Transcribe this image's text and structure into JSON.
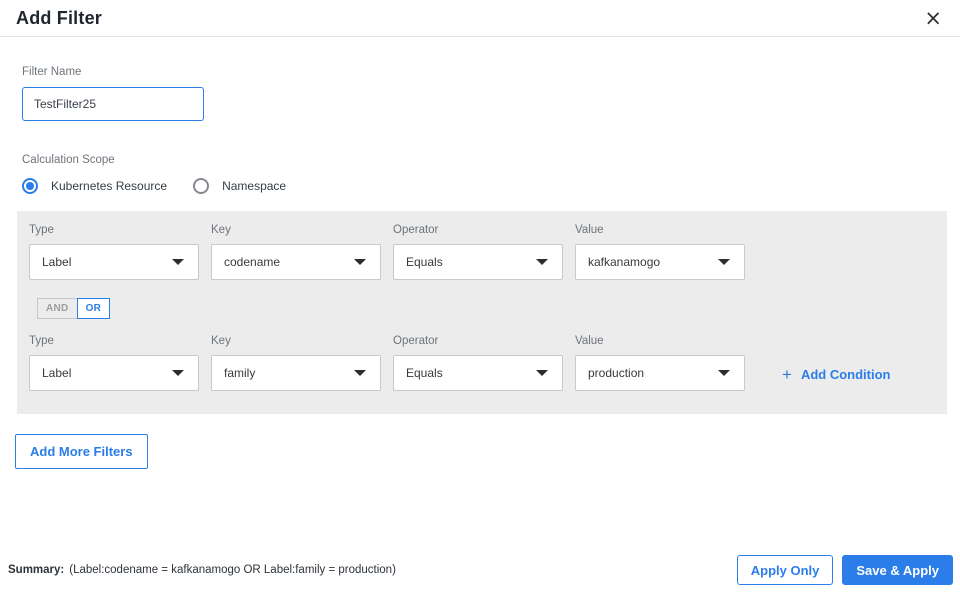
{
  "dialog": {
    "title": "Add Filter",
    "close_icon": "×"
  },
  "filter_name": {
    "label": "Filter Name",
    "value": "TestFilter25"
  },
  "calculation_scope": {
    "label": "Calculation Scope",
    "options": [
      {
        "label": "Kubernetes Resource",
        "selected": true
      },
      {
        "label": "Namespace",
        "selected": false
      }
    ]
  },
  "conditions": {
    "column_labels": {
      "type": "Type",
      "key": "Key",
      "operator": "Operator",
      "value": "Value"
    },
    "rows": [
      {
        "type": "Label",
        "key": "codename",
        "operator": "Equals",
        "value": "kafkanamogo"
      },
      {
        "type": "Label",
        "key": "family",
        "operator": "Equals",
        "value": "production"
      }
    ],
    "logic_toggle": {
      "and_label": "AND",
      "or_label": "OR",
      "selected": "OR"
    },
    "add_condition": {
      "plus_icon": "+",
      "label": "Add Condition"
    }
  },
  "buttons": {
    "add_more_filters": "Add More Filters",
    "apply_only": "Apply Only",
    "save_and_apply": "Save & Apply"
  },
  "summary": {
    "label": "Summary:",
    "text": "(Label:codename = kafkanamogo OR Label:family = production)"
  },
  "colors": {
    "accent_blue": "#2b7de9",
    "panel_background": "#ececec"
  }
}
